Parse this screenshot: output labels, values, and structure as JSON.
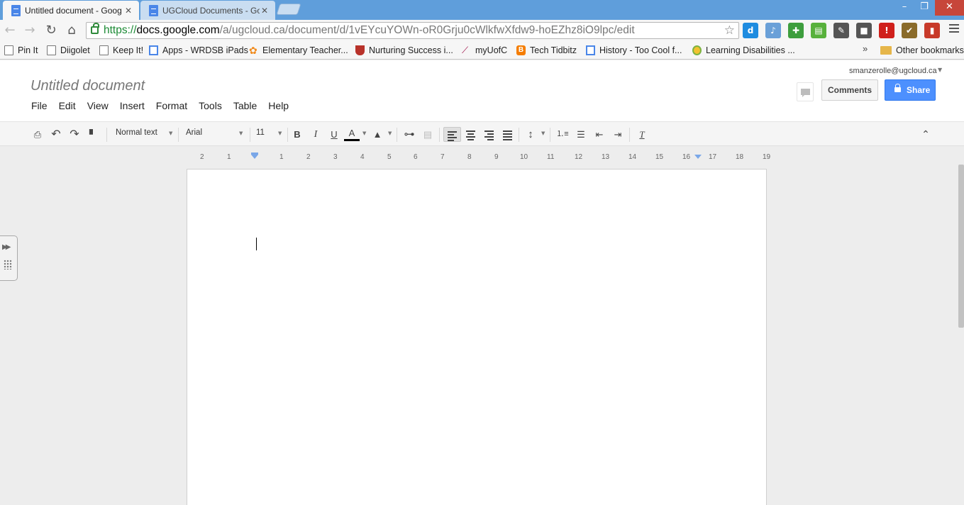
{
  "browser": {
    "tabs": [
      {
        "title": "Untitled document - Goog",
        "active": true
      },
      {
        "title": "UGCloud Documents - Go",
        "active": false
      }
    ],
    "window_controls": {
      "minimize": "–",
      "maximize": "❐",
      "close": "✕"
    },
    "address_bar": {
      "scheme": "https://",
      "host": "docs.google.com",
      "path": "/a/ugcloud.ca/document/d/1vEYcuYOWn-oR0Grju0cWlkfwXfdw9-hoEZhz8iO9lpc/edit"
    },
    "extensions": [
      {
        "name": "diigo-icon",
        "color": "#1f8ce0",
        "glyph": "d"
      },
      {
        "name": "speaker-icon",
        "color": "#6aa0d8",
        "glyph": "♪"
      },
      {
        "name": "puzzle-icon",
        "color": "#3e9e3e",
        "glyph": "✚"
      },
      {
        "name": "print-friendly-icon",
        "color": "#58b13c",
        "glyph": "▤"
      },
      {
        "name": "pen-icon",
        "color": "#555555",
        "glyph": "✎"
      },
      {
        "name": "camera-icon",
        "color": "#555555",
        "glyph": "■"
      },
      {
        "name": "alert-icon",
        "color": "#d0201b",
        "glyph": "!"
      },
      {
        "name": "check-icon",
        "color": "#8a6b2a",
        "glyph": "✔"
      },
      {
        "name": "book-icon",
        "color": "#c83a2a",
        "glyph": "▮"
      }
    ],
    "bookmarks": [
      {
        "label": "Pin It",
        "icon": "page-icon"
      },
      {
        "label": "Diigolet",
        "icon": "page-icon"
      },
      {
        "label": "Keep It!",
        "icon": "page-icon"
      },
      {
        "label": "Apps - WRDSB iPads",
        "icon": "docs-icon"
      },
      {
        "label": "Elementary Teacher...",
        "icon": "flower-icon"
      },
      {
        "label": "Nurturing Success i...",
        "icon": "shield-icon"
      },
      {
        "label": "myUofC",
        "icon": "feather-icon"
      },
      {
        "label": "Tech Tidbitz",
        "icon": "blogger-icon"
      },
      {
        "label": "History - Too Cool f...",
        "icon": "docs-icon"
      },
      {
        "label": "Learning Disabilities ...",
        "icon": "ld-icon"
      }
    ],
    "bookmarks_overflow": "»",
    "other_bookmarks": "Other bookmarks"
  },
  "docs": {
    "title": "Untitled document",
    "menus": [
      "File",
      "Edit",
      "View",
      "Insert",
      "Format",
      "Tools",
      "Table",
      "Help"
    ],
    "account": "smanzerolle@ugcloud.ca",
    "comments_label": "Comments",
    "share_label": "Share",
    "toolbar": {
      "style": "Normal text",
      "font": "Arial",
      "size": "11"
    },
    "ruler_numbers": [
      "2",
      "1",
      "1",
      "2",
      "3",
      "4",
      "5",
      "6",
      "7",
      "8",
      "9",
      "10",
      "11",
      "12",
      "13",
      "14",
      "15",
      "16",
      "17",
      "18",
      "19"
    ]
  }
}
